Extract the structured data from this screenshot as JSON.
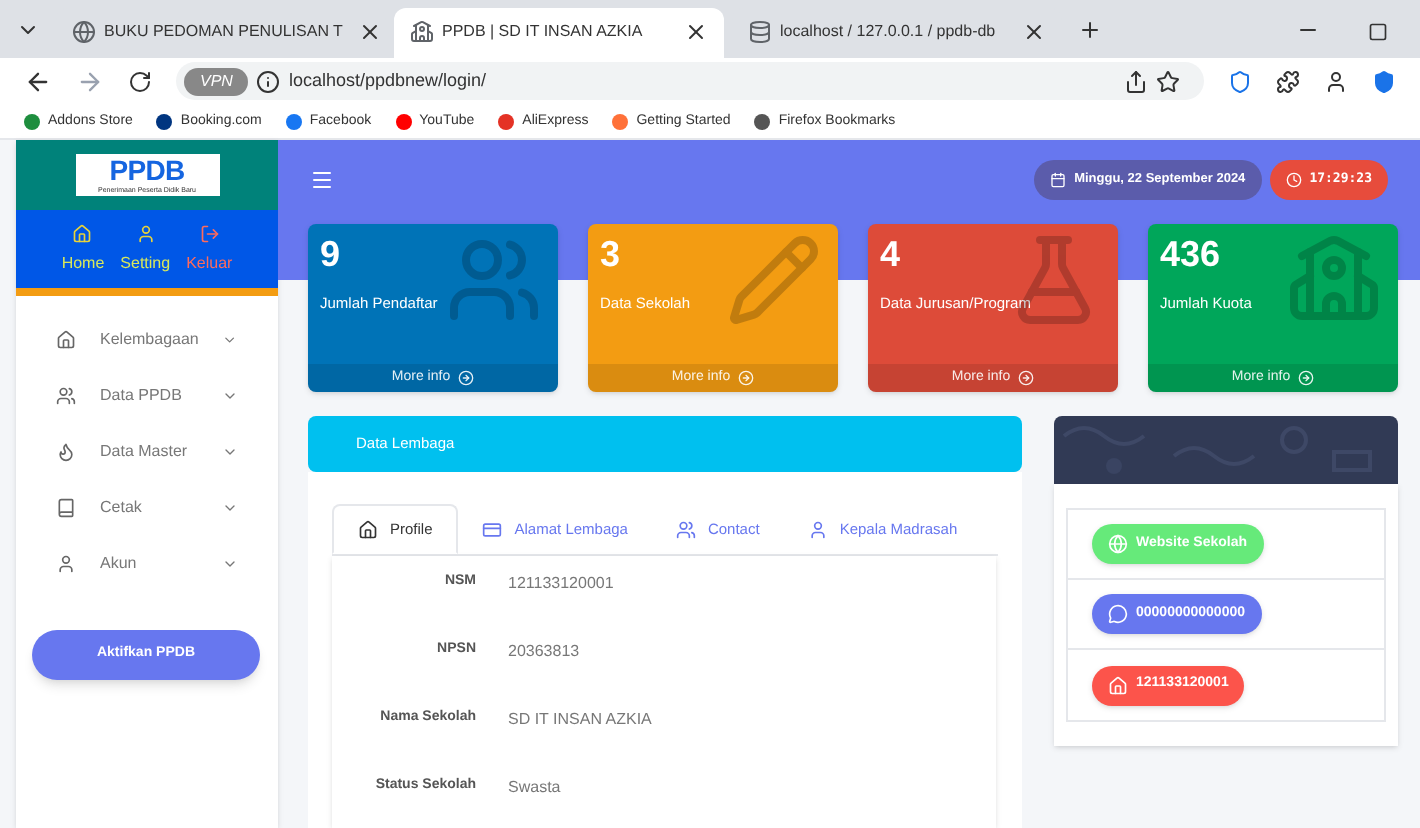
{
  "browser": {
    "tabs": [
      {
        "title": "BUKU PEDOMAN PENULISAN T",
        "selected": false,
        "kind": "globe"
      },
      {
        "title": "PPDB | SD IT INSAN AZKIA",
        "selected": true,
        "kind": "site"
      },
      {
        "title": "localhost / 127.0.0.1 / ppdb-db",
        "selected": false,
        "kind": "db"
      }
    ],
    "vpn": "VPN",
    "url": "localhost/ppdbnew/login/",
    "bookmarks": [
      {
        "label": "Addons Store",
        "color": "#1e8e3e"
      },
      {
        "label": "Booking.com",
        "color": "#003580"
      },
      {
        "label": "Facebook",
        "color": "#1877f2"
      },
      {
        "label": "YouTube",
        "color": "#ff0000"
      },
      {
        "label": "AliExpress",
        "color": "#e43225"
      },
      {
        "label": "Getting Started",
        "color": "#ff7139"
      },
      {
        "label": "Firefox Bookmarks",
        "color": "#555555"
      }
    ]
  },
  "logo": {
    "title": "PPDB",
    "subtitle": "Penerimaan Peserta Didik Baru"
  },
  "quick_nav": [
    {
      "label": "Home",
      "kind": "home"
    },
    {
      "label": "Setting",
      "kind": "user"
    },
    {
      "label": "Keluar",
      "kind": "logout"
    }
  ],
  "sidebar": {
    "items": [
      {
        "label": "Kelembagaan",
        "kind": "home"
      },
      {
        "label": "Data PPDB",
        "kind": "users"
      },
      {
        "label": "Data Master",
        "kind": "fire"
      },
      {
        "label": "Cetak",
        "kind": "book"
      },
      {
        "label": "Akun",
        "kind": "user"
      }
    ],
    "button": "Aktifkan PPDB"
  },
  "header": {
    "date": "Minggu, 22 September 2024",
    "time": "17:29:23"
  },
  "stats": [
    {
      "value": "9",
      "label": "Jumlah Pendaftar",
      "link": "More info",
      "color": "#0073b7",
      "kind": "users"
    },
    {
      "value": "3",
      "label": "Data Sekolah",
      "link": "More info",
      "color": "#f39c12",
      "kind": "edit"
    },
    {
      "value": "4",
      "label": "Data Jurusan/Program",
      "link": "More info",
      "color": "#dd4b39",
      "kind": "flask"
    },
    {
      "value": "436",
      "label": "Jumlah Kuota",
      "link": "More info",
      "color": "#00a65a",
      "kind": "school"
    }
  ],
  "panel": {
    "title": "Data Lembaga",
    "tabs": [
      {
        "label": "Profile",
        "selected": true,
        "kind": "home"
      },
      {
        "label": "Alamat Lembaga",
        "selected": false,
        "kind": "card"
      },
      {
        "label": "Contact",
        "selected": false,
        "kind": "users"
      },
      {
        "label": "Kepala Madrasah",
        "selected": false,
        "kind": "user"
      }
    ],
    "fields": [
      {
        "label": "NSM",
        "value": "121133120001"
      },
      {
        "label": "NPSN",
        "value": "20363813"
      },
      {
        "label": "Nama Sekolah",
        "value": "SD IT INSAN AZKIA"
      },
      {
        "label": "Status Sekolah",
        "value": "Swasta"
      }
    ]
  },
  "contact_buttons": [
    {
      "label": "Website Sekolah",
      "color": "#66ea7a",
      "kind": "globe"
    },
    {
      "label": "00000000000000",
      "color": "#6777ef",
      "kind": "whatsapp"
    },
    {
      "label": "121133120001",
      "color": "#fc544b",
      "kind": "home"
    }
  ]
}
